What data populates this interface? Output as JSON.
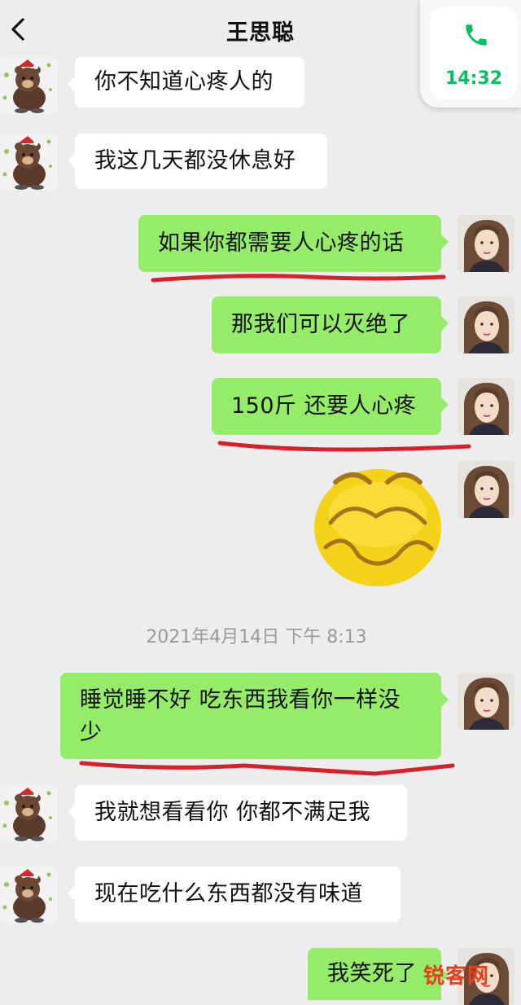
{
  "header": {
    "title": "王思聪"
  },
  "call": {
    "time": "14:32"
  },
  "timestamp": "2021年4月14日 下午 8:13",
  "messages": [
    {
      "text": "你不知道心疼人的"
    },
    {
      "text": "我这几天都没休息好"
    },
    {
      "text": "如果你都需要人心疼的话"
    },
    {
      "text": "那我们可以灭绝了"
    },
    {
      "text": "150斤 还要人心疼"
    },
    {
      "text": "睡觉睡不好 吃东西我看你一样没少"
    },
    {
      "text": "我就想看看你 你都不满足我"
    },
    {
      "text": "现在吃什么东西都没有味道"
    },
    {
      "text": "我笑死了"
    }
  ],
  "watermark": "锐客网",
  "colors": {
    "accent": "#07c160",
    "bubble_right": "#95ec69",
    "underline": "#d9202a"
  }
}
